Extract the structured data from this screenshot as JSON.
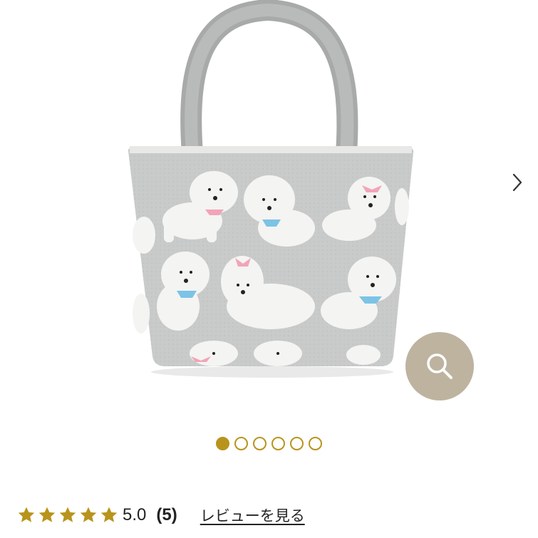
{
  "rating": {
    "stars": 5,
    "value": "5.0",
    "count": "(5)",
    "review_link_label": "レビューを見る"
  },
  "gallery": {
    "total_images": 6,
    "current_index": 1
  },
  "colors": {
    "accent": "#b8941c",
    "star": "#b8941c",
    "zoom_button": "#bdb39f",
    "bag_body": "#c9cbcb",
    "bag_handle": "#a8aaa9"
  },
  "icons": {
    "next": "chevron-right-icon",
    "zoom": "search-icon",
    "star": "star-icon"
  }
}
